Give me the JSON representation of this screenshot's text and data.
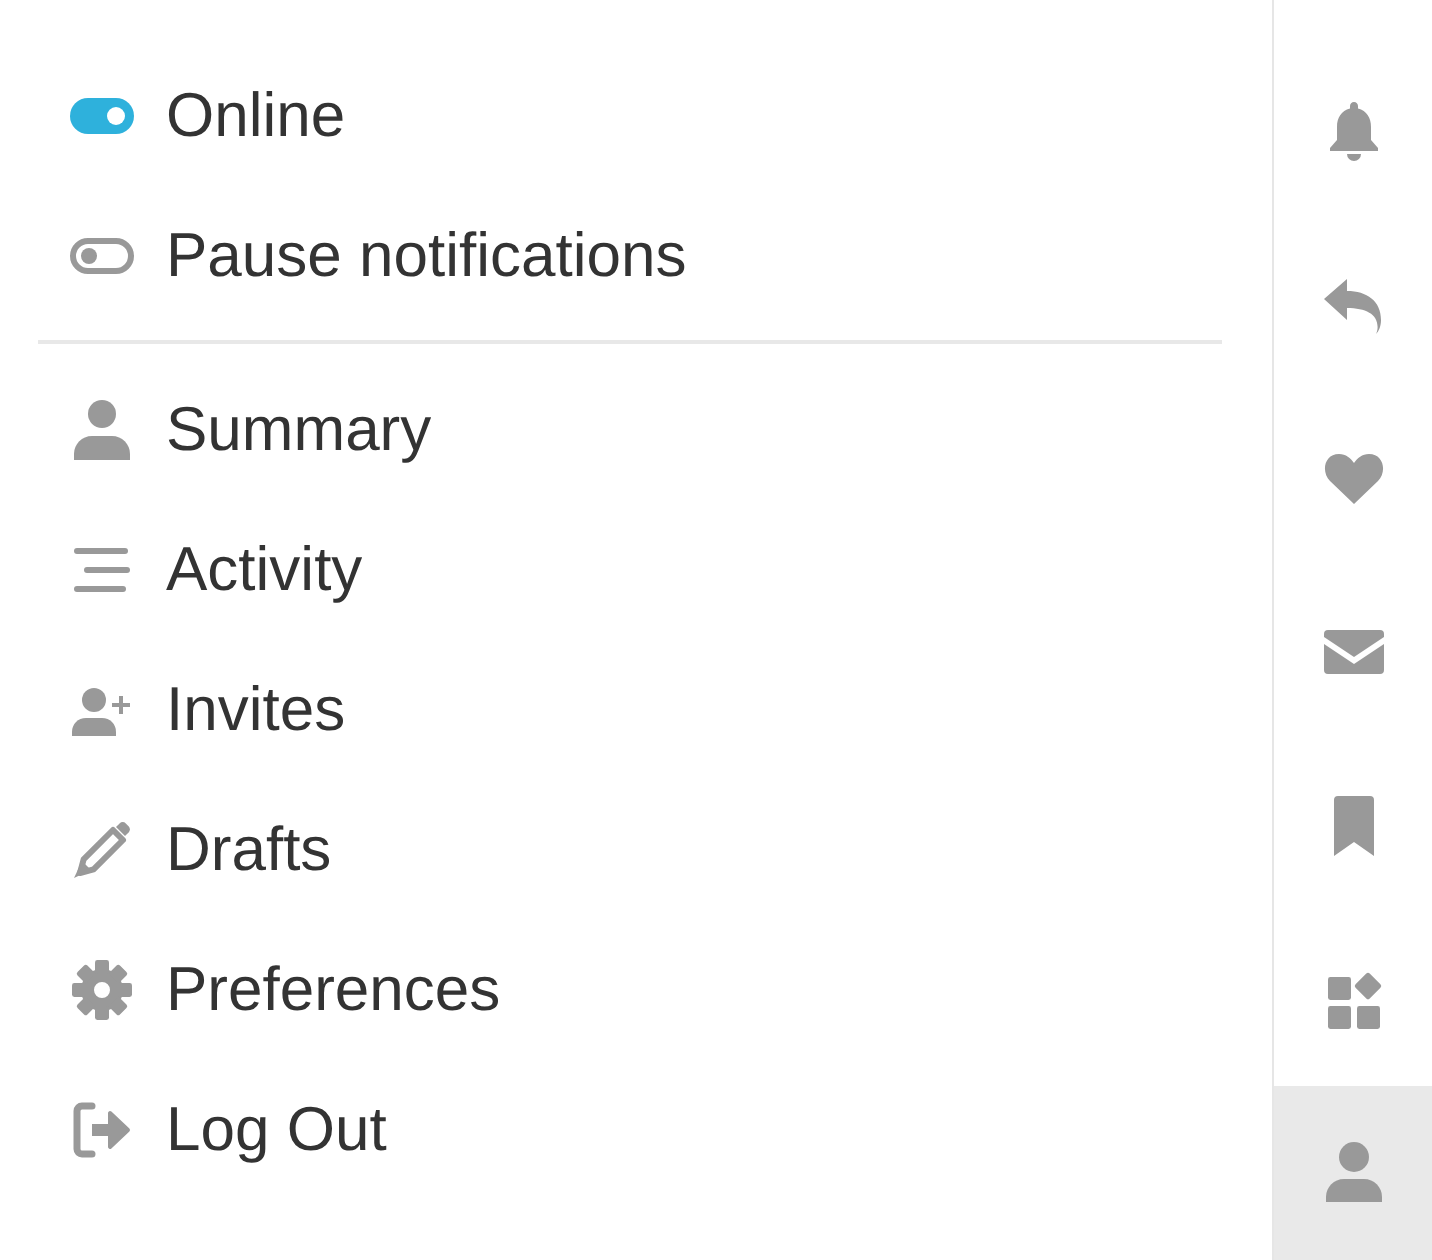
{
  "status_toggles": [
    {
      "label": "Online",
      "on": true
    },
    {
      "label": "Pause notifications",
      "on": false
    }
  ],
  "menu": [
    {
      "label": "Summary"
    },
    {
      "label": "Activity"
    },
    {
      "label": "Invites"
    },
    {
      "label": "Drafts"
    },
    {
      "label": "Preferences"
    },
    {
      "label": "Log Out"
    }
  ],
  "sidebar": {
    "items": [
      {
        "selected": false
      },
      {
        "selected": false
      },
      {
        "selected": false
      },
      {
        "selected": false
      },
      {
        "selected": false
      },
      {
        "selected": false
      },
      {
        "selected": true
      }
    ]
  }
}
